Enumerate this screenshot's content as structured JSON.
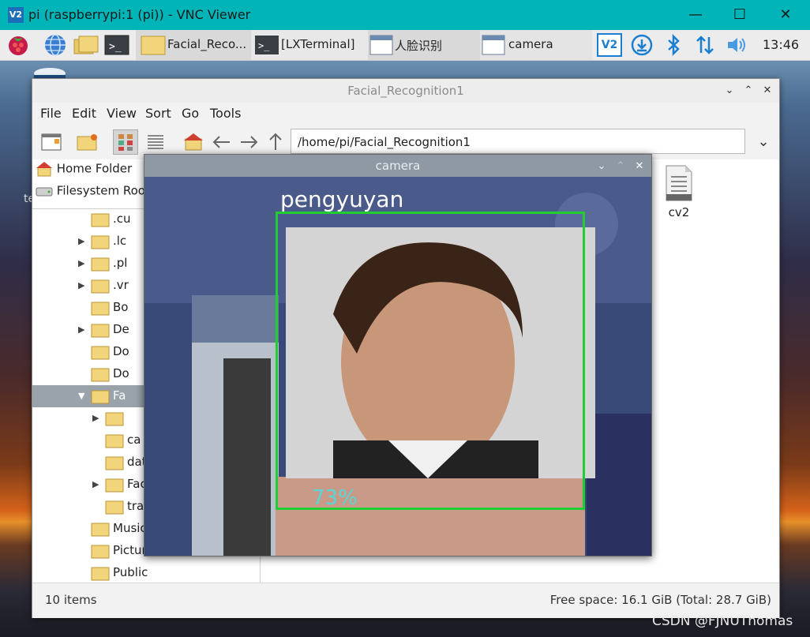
{
  "vnc": {
    "title": "pi (raspberrypi:1 (pi)) - VNC Viewer",
    "logo_text": "V2",
    "min_glyph": "—",
    "max_glyph": "☐",
    "close_glyph": "✕"
  },
  "taskbar": {
    "tasks": [
      {
        "label": "Facial_Reco..."
      },
      {
        "label": "[LXTerminal]"
      },
      {
        "label": "人脸识别"
      },
      {
        "label": "camera"
      }
    ],
    "clock": "13:46",
    "vnc_tray_text": "V2"
  },
  "desktop": {
    "partial_label": "te"
  },
  "file_manager": {
    "title": "Facial_Recognition1",
    "menu": [
      "File",
      "Edit",
      "View",
      "Sort",
      "Go",
      "Tools"
    ],
    "path": "/home/pi/Facial_Recognition1",
    "places": [
      {
        "label": "Home Folder"
      },
      {
        "label": "Filesystem Roo"
      }
    ],
    "tree": [
      {
        "label": ".cu",
        "indent": 1,
        "expander": false,
        "selected": false
      },
      {
        "label": ".lc",
        "indent": 1,
        "expander": true,
        "selected": false
      },
      {
        "label": ".pl",
        "indent": 1,
        "expander": true,
        "selected": false
      },
      {
        "label": ".vr",
        "indent": 1,
        "expander": true,
        "selected": false
      },
      {
        "label": "Bo",
        "indent": 1,
        "expander": false,
        "selected": false
      },
      {
        "label": "De",
        "indent": 1,
        "expander": true,
        "selected": false
      },
      {
        "label": "Do",
        "indent": 1,
        "expander": false,
        "selected": false
      },
      {
        "label": "Do",
        "indent": 1,
        "expander": false,
        "selected": false
      },
      {
        "label": "Fa",
        "indent": 1,
        "expander": true,
        "selected": true
      },
      {
        "label": "",
        "indent": 2,
        "expander": true,
        "selected": false
      },
      {
        "label": "ca",
        "indent": 2,
        "expander": false,
        "selected": false
      },
      {
        "label": "dat",
        "indent": 2,
        "expander": false,
        "selected": false
      },
      {
        "label": "Fac",
        "indent": 2,
        "expander": true,
        "selected": false
      },
      {
        "label": "tra",
        "indent": 2,
        "expander": false,
        "selected": false
      },
      {
        "label": "Music",
        "indent": 1,
        "expander": false,
        "selected": false
      },
      {
        "label": "Pictur",
        "indent": 1,
        "expander": false,
        "selected": false
      },
      {
        "label": "Public",
        "indent": 1,
        "expander": false,
        "selected": false
      }
    ],
    "files": [
      {
        "label": "cv2"
      }
    ],
    "status_items": "10 items",
    "status_free": "Free space: 16.1 GiB (Total: 28.7 GiB)"
  },
  "camera_window": {
    "title": "camera",
    "detected_name": "pengyuyan",
    "confidence": "73%"
  },
  "watermark": "CSDN @FJNUThomas"
}
